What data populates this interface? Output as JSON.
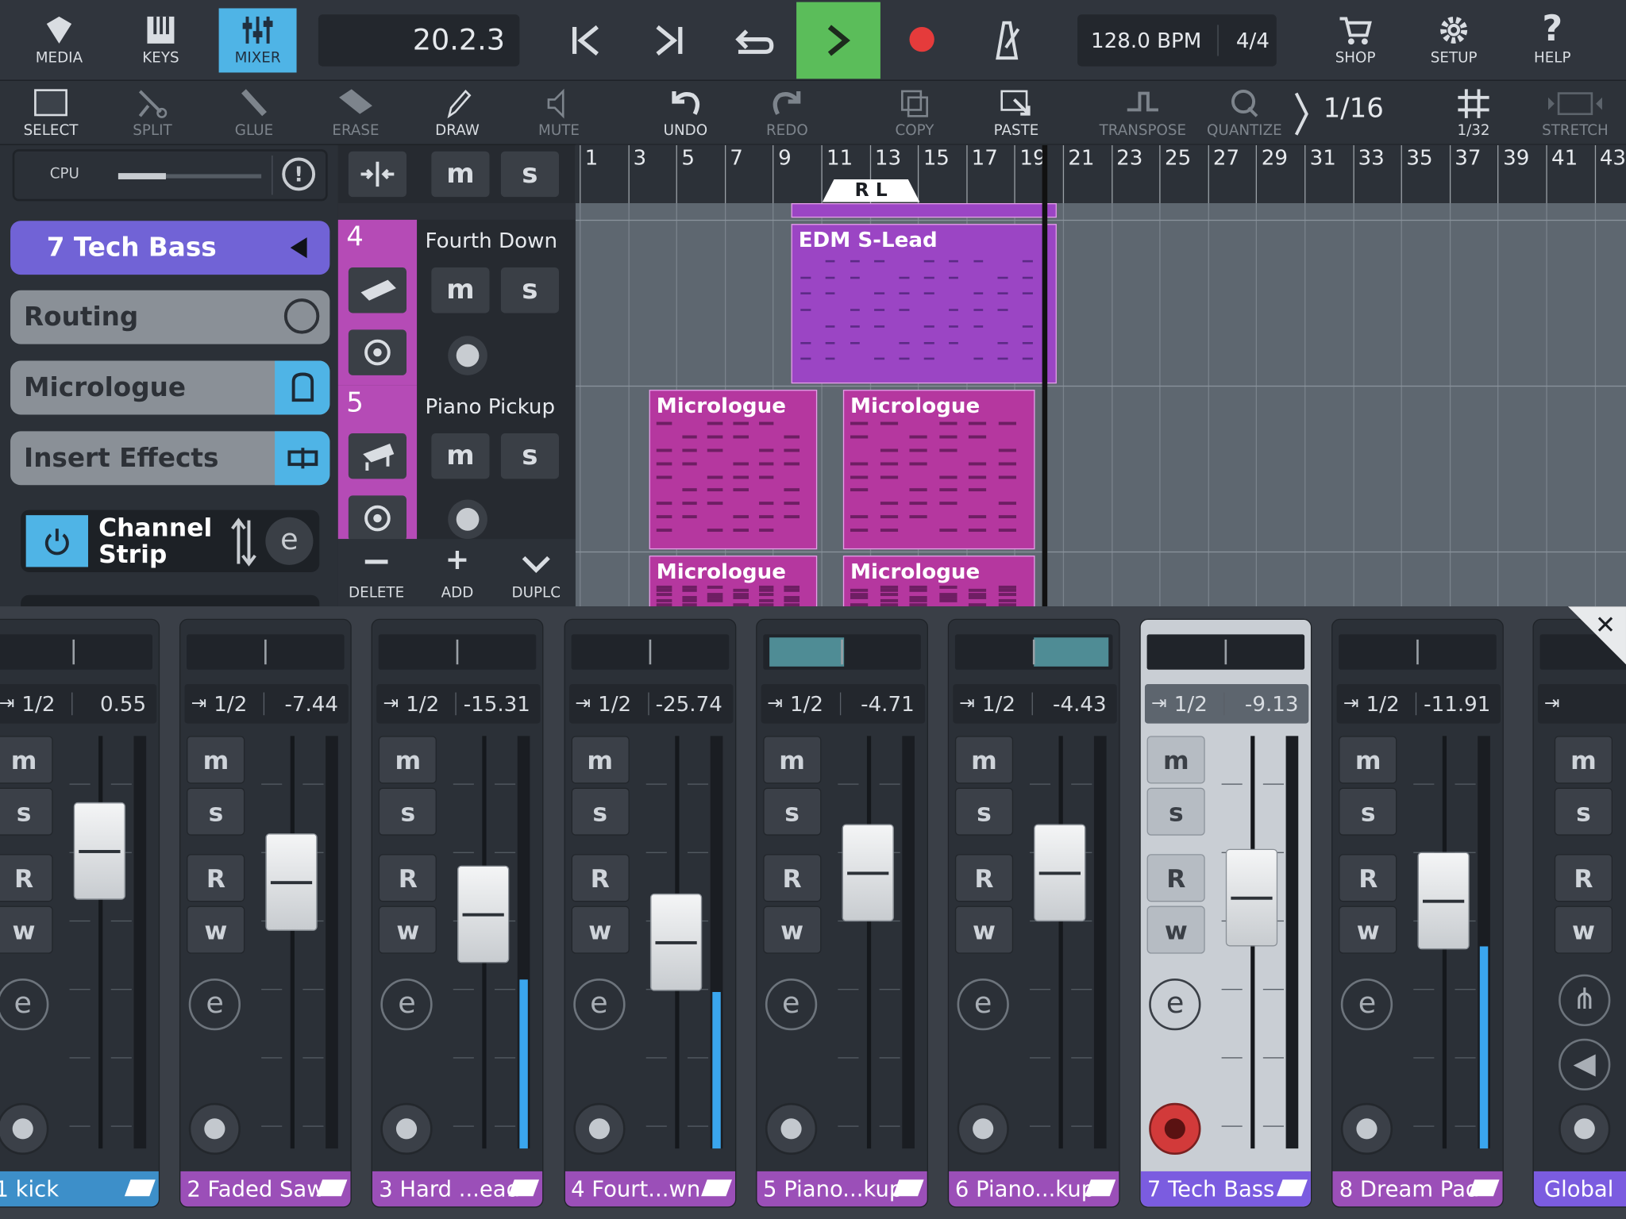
{
  "topbar": {
    "media": "MEDIA",
    "keys": "KEYS",
    "mixer": "MIXER",
    "position": "20.2.3",
    "tempo": "128.0 BPM",
    "signature": "4/4",
    "shop": "SHOP",
    "setup": "SETUP",
    "help": "HELP"
  },
  "tools": {
    "select": "SELECT",
    "split": "SPLIT",
    "glue": "GLUE",
    "erase": "ERASE",
    "draw": "DRAW",
    "mute": "MUTE",
    "undo": "UNDO",
    "redo": "REDO",
    "copy": "COPY",
    "paste": "PASTE",
    "transpose": "TRANSPOSE",
    "quantize": "QUANTIZE",
    "grid": "1/16",
    "grid_sub": "1/32",
    "stretch": "STRETCH"
  },
  "left": {
    "cpu": "CPU",
    "track": "7  Tech Bass",
    "routing": "Routing",
    "instrument": "Micrologue",
    "insert": "Insert Effects",
    "channel_strip_1": "Channel",
    "channel_strip_2": "Strip"
  },
  "trackcol": {
    "track4_num": "4",
    "track4_name": "Fourth Down",
    "track5_num": "5",
    "track5_name": "Piano Pickup",
    "m": "m",
    "s": "s",
    "delete": "DELETE",
    "add": "ADD",
    "dupl": "DUPLC"
  },
  "ruler": {
    "ticks": [
      "1",
      "3",
      "5",
      "7",
      "9",
      "11",
      "13",
      "15",
      "17",
      "19",
      "21",
      "23",
      "25",
      "27",
      "29",
      "31",
      "33",
      "35",
      "37",
      "39",
      "41",
      "43"
    ],
    "locator": "R  L"
  },
  "clips": {
    "edm": "EDM S-Lead",
    "micro1": "Micrologue",
    "micro2": "Micrologue",
    "micro3": "Micrologue",
    "micro4": "Micrologue"
  },
  "mixer": {
    "routes": [
      "1/2",
      "1/2",
      "1/2",
      "1/2",
      "1/2",
      "1/2",
      "1/2",
      "1/2"
    ],
    "values": [
      "0.55",
      "-7.44",
      "-15.31",
      "-25.74",
      "-4.71",
      "-4.43",
      "-9.13",
      "-11.91"
    ],
    "names": [
      "1    kick",
      "2  Faded Saw",
      "3  Hard ...ead",
      "4  Fourt...wn",
      "5  Piano...kup",
      "6  Piano...kup",
      "7  Tech Bass",
      "8  Dream Pad"
    ],
    "fader_levels_0to1": [
      0.79,
      0.69,
      0.59,
      0.5,
      0.72,
      0.72,
      0.64,
      0.63
    ],
    "meter_levels_0to1": [
      0,
      0,
      0.41,
      0.38,
      0,
      0,
      0,
      0.49
    ],
    "m": "m",
    "s": "s",
    "r": "R",
    "w": "w",
    "global": "Global"
  },
  "colors": {
    "accent": "#4fb4e6",
    "play": "#5bbd5a",
    "record": "#e53b3b",
    "clip": "#b54bb6"
  }
}
